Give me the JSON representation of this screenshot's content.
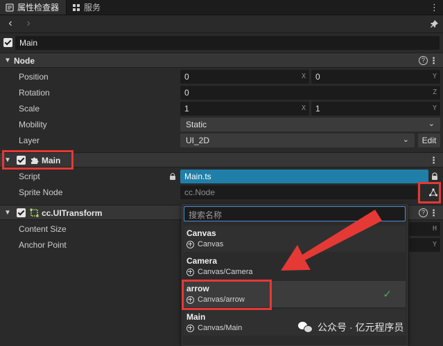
{
  "tabs": [
    {
      "label": "属性检查器",
      "icon": "inspector-icon"
    },
    {
      "label": "服务",
      "icon": "grid-icon"
    }
  ],
  "nav": {
    "back": "‹",
    "forward": "›"
  },
  "node_name": "Main",
  "sections": {
    "node": {
      "title": "Node",
      "position": {
        "label": "Position",
        "x": "0",
        "y": "0"
      },
      "rotation": {
        "label": "Rotation",
        "z": "0"
      },
      "scale": {
        "label": "Scale",
        "x": "1",
        "y": "1"
      },
      "mobility": {
        "label": "Mobility",
        "value": "Static"
      },
      "layer": {
        "label": "Layer",
        "value": "UI_2D",
        "edit": "Edit"
      }
    },
    "main": {
      "title": "Main",
      "script": {
        "label": "Script",
        "value": "Main.ts"
      },
      "sprite_node": {
        "label": "Sprite Node",
        "value": "cc.Node"
      }
    },
    "uitransform": {
      "title": "cc.UITransform",
      "content_size": {
        "label": "Content Size"
      },
      "anchor_point": {
        "label": "Anchor Point"
      }
    }
  },
  "axes": {
    "x": "X",
    "y": "Y",
    "z": "Z",
    "h": "H"
  },
  "dropdown": {
    "search_placeholder": "搜索名称",
    "items": [
      {
        "name": "Canvas",
        "path": "Canvas"
      },
      {
        "name": "Camera",
        "path": "Canvas/Camera"
      },
      {
        "name": "arrow",
        "path": "Canvas/arrow"
      },
      {
        "name": "Main",
        "path": "Canvas/Main"
      }
    ]
  },
  "watermark": "公众号 · 亿元程序员",
  "colors": {
    "accent": "#4c8dd6",
    "highlight": "#e53935",
    "script_field": "#1f7fa8",
    "check": "#4caf50"
  }
}
